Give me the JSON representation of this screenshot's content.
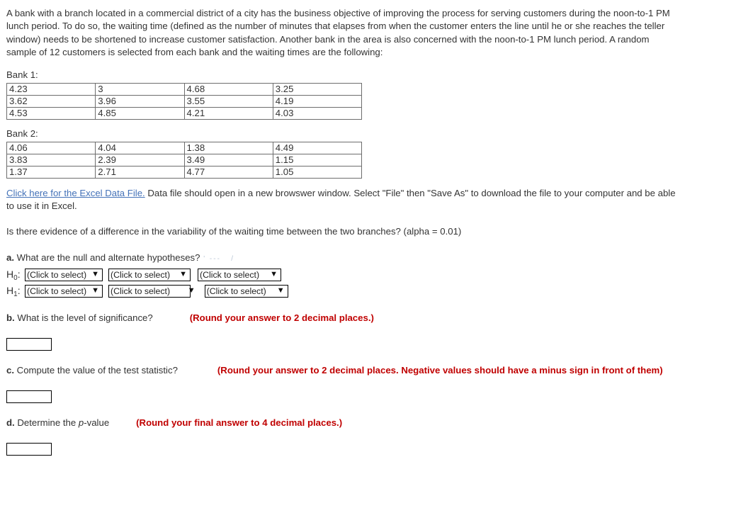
{
  "intro": {
    "paragraph": "A bank with a branch located in a commercial district of a city has the business objective of improving the process for serving customers during the noon-to-1 PM lunch period. To do so, the waiting time (defined as the number of minutes that elapses from when the customer enters the line until he or she reaches the teller window) needs to be shortened to increase customer satisfaction. Another bank in the area is also concerned with the noon-to-1 PM lunch period. A random sample of 12 customers is selected from each bank and the waiting times are the following:"
  },
  "bank1": {
    "label": "Bank 1:",
    "rows": [
      [
        "4.23",
        "3",
        "4.68",
        "3.25"
      ],
      [
        "3.62",
        "3.96",
        "3.55",
        "4.19"
      ],
      [
        "4.53",
        "4.85",
        "4.21",
        "4.03"
      ]
    ]
  },
  "bank2": {
    "label": "Bank 2:",
    "rows": [
      [
        "4.06",
        "4.04",
        "1.38",
        "4.49"
      ],
      [
        "3.83",
        "2.39",
        "3.49",
        "1.15"
      ],
      [
        "1.37",
        "2.71",
        "4.77",
        "1.05"
      ]
    ]
  },
  "excel": {
    "link_text": "Click here for the Excel Data File.",
    "after_text": " Data file should open in a new browswer window. Select \"File\" then \"Save As\" to download the file to your computer and be able to use it in Excel."
  },
  "question": {
    "text": "Is there evidence of a difference in the variability of the waiting time between the two branches? (alpha = 0.01)"
  },
  "parts": {
    "a": {
      "marker": "a.",
      "text": " What are the null and alternate hypotheses?",
      "h0_label": "H",
      "h0_sub": "0",
      "h0_colon": ":",
      "h1_label": "H",
      "h1_sub": "1",
      "h1_colon": ":",
      "select_placeholder": "(Click to select)",
      "select_options": [
        "(Click to select)"
      ],
      "chevron": "⌄"
    },
    "b": {
      "marker": "b.",
      "text": " What is the level of significance?",
      "note": "(Round your answer to 2 decimal places.)",
      "input_value": ""
    },
    "c": {
      "marker": "c.",
      "text": " Compute the value of the test statistic?",
      "note": "(Round your answer to 2 decimal places. Negative values should have a minus sign in front of them)",
      "input_value": ""
    },
    "d": {
      "marker": "d.",
      "text_before": " Determine the ",
      "text_italic": "p",
      "text_after": "-value",
      "note": "(Round your final answer to 4 decimal places.)",
      "input_value": ""
    }
  },
  "colors": {
    "body_text": "#333333",
    "link": "#4472b8",
    "note_red": "#c00000",
    "border": "#000000",
    "table_border": "#6d6d6d"
  }
}
